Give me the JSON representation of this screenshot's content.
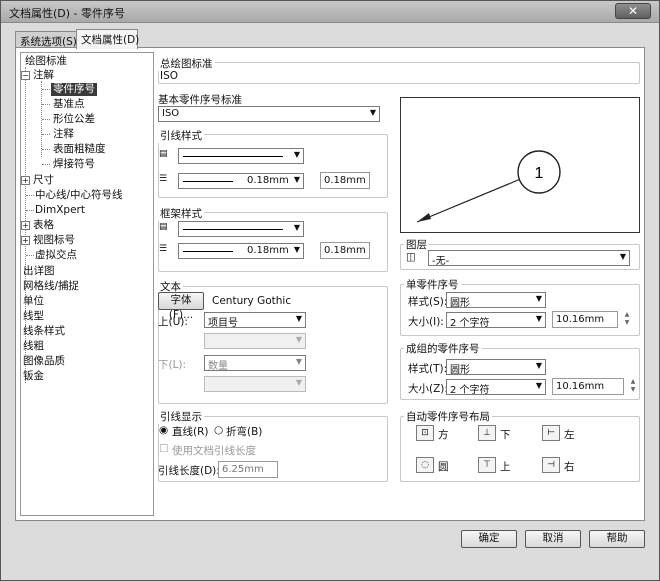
{
  "window": {
    "title": "文档属性(D) - 零件序号",
    "close_label": "✕"
  },
  "tabs": [
    {
      "label": "系统选项(S)"
    },
    {
      "label": "文档属性(D)"
    }
  ],
  "tree": {
    "items": [
      {
        "label": "绘图标准"
      },
      {
        "label": "注解"
      },
      {
        "label": "零件序号"
      },
      {
        "label": "基准点"
      },
      {
        "label": "形位公差"
      },
      {
        "label": "注释"
      },
      {
        "label": "表面粗糙度"
      },
      {
        "label": "焊接符号"
      },
      {
        "label": "尺寸"
      },
      {
        "label": "中心线/中心符号线"
      },
      {
        "label": "DimXpert"
      },
      {
        "label": "表格"
      },
      {
        "label": "视图标号"
      },
      {
        "label": "虚拟交点"
      },
      {
        "label": "出详图"
      },
      {
        "label": "网格线/捕捉"
      },
      {
        "label": "单位"
      },
      {
        "label": "线型"
      },
      {
        "label": "线条样式"
      },
      {
        "label": "线粗"
      },
      {
        "label": "图像品质"
      },
      {
        "label": "钣金"
      }
    ]
  },
  "overall_standard": {
    "label": "总绘图标准",
    "value": "ISO"
  },
  "base_standard": {
    "label": "基本零件序号标准",
    "value": "ISO"
  },
  "leader_style": {
    "label": "引线样式",
    "line_width_value": "0.18mm",
    "custom_value": "0.18mm"
  },
  "frame_style": {
    "label": "框架样式",
    "line_width_value": "0.18mm",
    "custom_value": "0.18mm"
  },
  "text": {
    "label": "文本",
    "font_button": "字体(F)...",
    "font_name": "Century Gothic",
    "upper_label": "上(U):",
    "upper_value": "项目号",
    "lower_label": "下(L):",
    "lower_value": "数量"
  },
  "leader_display": {
    "label": "引线显示",
    "straight_label": "直线(R)",
    "bent_label": "折弯(B)",
    "use_doc_leader_label": "使用文档引线长度",
    "leader_length_label": "引线长度(D):",
    "leader_length_value": "6.25mm"
  },
  "preview": {
    "balloon_number": "1"
  },
  "layer": {
    "label": "图层",
    "value": "-无-"
  },
  "single_balloon": {
    "label": "单零件序号",
    "style_label": "样式(S):",
    "style_value": "圆形",
    "size_label": "大小(I):",
    "size_value": "2 个字符",
    "size_custom": "10.16mm"
  },
  "stacked_balloon": {
    "label": "成组的零件序号",
    "style_label": "样式(T):",
    "style_value": "圆形",
    "size_label": "大小(Z):",
    "size_value": "2 个字符",
    "size_custom": "10.16mm"
  },
  "auto_balloon_layout": {
    "label": "自动零件序号布局",
    "options": [
      {
        "label": "方"
      },
      {
        "label": "下"
      },
      {
        "label": "左"
      },
      {
        "label": "圆"
      },
      {
        "label": "上"
      },
      {
        "label": "右"
      }
    ]
  },
  "footer": {
    "ok": "确定",
    "cancel": "取消",
    "help": "帮助"
  }
}
